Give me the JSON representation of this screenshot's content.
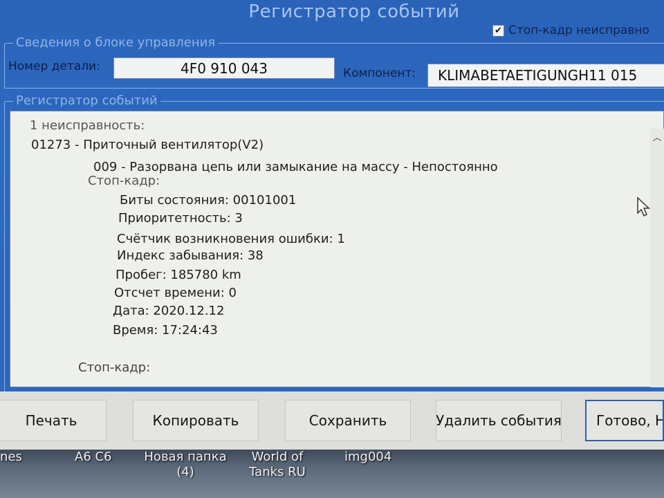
{
  "window": {
    "title": "Регистратор событий",
    "stop_frame_checkbox": {
      "label": "Стоп-кадр неисправно",
      "checked": true
    }
  },
  "control_unit": {
    "group_title": "Сведения о блоке управления",
    "part_number_label": "Номер детали:",
    "part_number": "4F0 910 043",
    "component_label": "Компонент:",
    "component": "KLIMABETAETIGUNGH11 015"
  },
  "event_log": {
    "group_title": "Регистратор событий",
    "lines": [
      "1 неисправность:",
      "01273 - Приточный вентилятор(V2)",
      "009 - Разорвана цепь или замыкание на массу - Непостоянно",
      "Стоп-кадр:",
      "Биты состояния: 00101001",
      "Приоритетность: 3",
      "Счётчик возникновения ошибки: 1",
      "Индекс забывания: 38",
      "Пробег: 185780 km",
      "Отсчет времени: 0",
      "Дата: 2020.12.12",
      "Время: 17:24:43",
      "Стоп-кадр:"
    ]
  },
  "buttons": {
    "print": "Печать",
    "copy": "Копировать",
    "save": "Сохранить",
    "delete_events": "Удалить события",
    "done": "Готово, На"
  },
  "desktop": {
    "items": [
      "nes",
      "A6 C6",
      "Новая папка (4)",
      "World of Tanks RU",
      "img004"
    ]
  },
  "colors": {
    "window_bg": "#2b66bd",
    "log_bg": "#eef0ec",
    "buttons_bg": "#dedfdb"
  }
}
